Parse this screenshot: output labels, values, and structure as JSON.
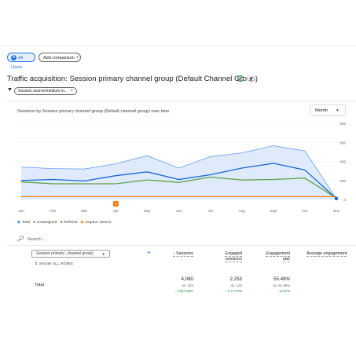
{
  "header": {
    "segment_chip": "All Users",
    "segment_chip_icon": "A",
    "add_comparison": "Add comparison"
  },
  "page": {
    "title": "Traffic acquisition: Session primary channel group (Default Channel Group)"
  },
  "filter": {
    "chip_label": "Session source/medium m..."
  },
  "chart": {
    "title": "Sessions by Session primary channel group (Default channel group) over time",
    "period_select": "Month",
    "annotation_marker": "×"
  },
  "chart_data": {
    "type": "line",
    "x": [
      "Jan",
      "Feb",
      "Mar",
      "Apr",
      "May",
      "Jun",
      "Jul",
      "Aug",
      "Sept",
      "Oct",
      "Nov"
    ],
    "y_ticks": [
      0,
      200,
      400,
      600,
      800
    ],
    "ylim": [
      0,
      850
    ],
    "legend_position": "bottom-left",
    "series": [
      {
        "name": "Total",
        "color": "#4285f4",
        "area": true,
        "values": [
          340,
          325,
          320,
          375,
          460,
          330,
          450,
          490,
          565,
          510,
          10
        ]
      },
      {
        "name": "Unassigned",
        "color": "#1967d2",
        "values": [
          200,
          210,
          195,
          250,
          290,
          210,
          260,
          330,
          380,
          310,
          10
        ]
      },
      {
        "name": "Referral",
        "color": "#5e9f43",
        "values": [
          185,
          165,
          165,
          165,
          205,
          180,
          235,
          205,
          210,
          225,
          15
        ]
      },
      {
        "name": "Organic Search",
        "color": "#fa7b17",
        "values": [
          30,
          30,
          30,
          30,
          30,
          30,
          30,
          30,
          30,
          30,
          30
        ]
      }
    ]
  },
  "search": {
    "placeholder": "Search..."
  },
  "table": {
    "dimension_select": "Session primary...channel group)",
    "show_all_rows": "SHOW ALL ROWS",
    "columns": [
      {
        "label_1": "↓ Sessions",
        "label_2": ""
      },
      {
        "label_1": "Engaged",
        "label_2": "sessions"
      },
      {
        "label_1": "Engagement",
        "label_2": "rate"
      },
      {
        "label_1": "Average engagement",
        "label_2": ""
      }
    ],
    "total": {
      "label": "Total",
      "sessions": "4,060",
      "sessions_vs": "vs. 223",
      "sessions_pct": "↑ 1,627.66%",
      "engaged": "2,253",
      "engaged_vs": "vs. 120",
      "engaged_pct": "↑ 1,777.5%",
      "rate": "55.49%",
      "rate_vs": "vs. 51.06%",
      "rate_pct": "↑ 8.67%"
    }
  }
}
